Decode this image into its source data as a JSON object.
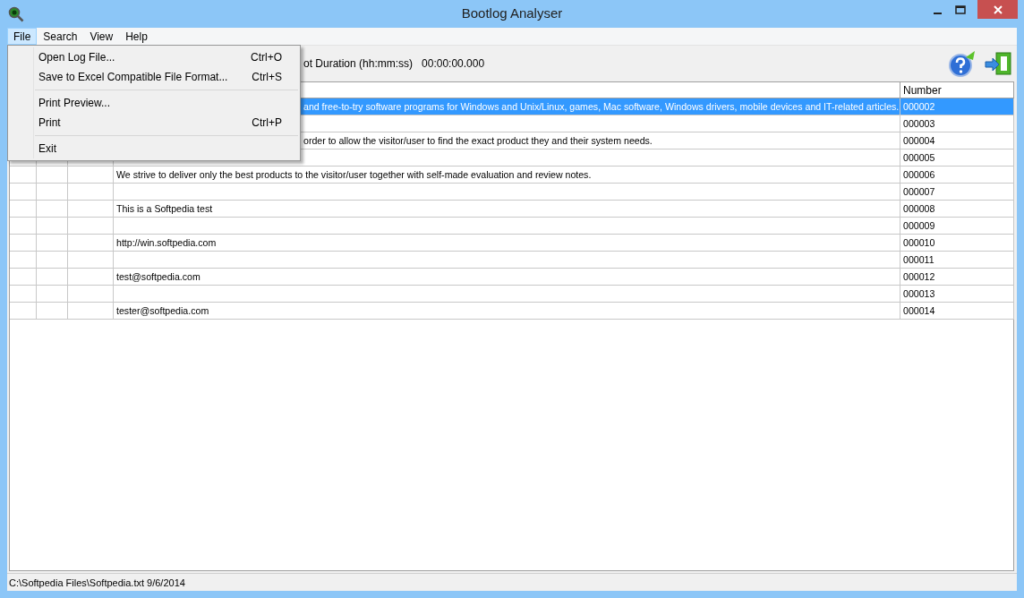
{
  "window": {
    "title": "Bootlog Analyser"
  },
  "menu_bar": [
    {
      "label": "File",
      "selected": true
    },
    {
      "label": "Search",
      "selected": false
    },
    {
      "label": "View",
      "selected": false
    },
    {
      "label": "Help",
      "selected": false
    }
  ],
  "file_menu": [
    {
      "kind": "item",
      "label": "Open Log File...",
      "shortcut": "Ctrl+O"
    },
    {
      "kind": "item",
      "label": "Save to Excel Compatible File Format...",
      "shortcut": "Ctrl+S"
    },
    {
      "kind": "separator"
    },
    {
      "kind": "item",
      "label": "Print Preview..."
    },
    {
      "kind": "item",
      "label": "Print",
      "shortcut": "Ctrl+P"
    },
    {
      "kind": "separator"
    },
    {
      "kind": "item",
      "label": "Exit"
    }
  ],
  "toolbar": {
    "duration_label": "ot Duration (hh:mm:ss)",
    "duration_value": "00:00:00.000"
  },
  "table": {
    "columns": [
      {
        "label": "Number"
      }
    ],
    "rows": [
      {
        "text": "and free-to-try software programs for Windows and Unix/Linux, games, Mac software, Windows drivers, mobile devices and IT-related articles.",
        "number": "000002",
        "selected": true
      },
      {
        "number": "000003",
        "selected": false
      },
      {
        "text": "order to allow the visitor/user to find the exact product they and their system needs.",
        "number": "000004",
        "selected": false
      },
      {
        "number": "000005",
        "selected": false
      },
      {
        "text": "We strive to deliver only the best products to the visitor/user together with self-made evaluation and review notes.",
        "number": "000006",
        "selected": false
      },
      {
        "number": "000007",
        "selected": false
      },
      {
        "text": "This is a Softpedia test",
        "number": "000008",
        "selected": false
      },
      {
        "number": "000009",
        "selected": false
      },
      {
        "text": "http://win.softpedia.com",
        "number": "000010",
        "selected": false
      },
      {
        "number": "000011",
        "selected": false
      },
      {
        "text": "test@softpedia.com",
        "number": "000012",
        "selected": false
      },
      {
        "number": "000013",
        "selected": false
      },
      {
        "text": "tester@softpedia.com",
        "number": "000014",
        "selected": false
      }
    ]
  },
  "status_bar": "C:\\Softpedia Files\\Softpedia.txt 9/6/2014"
}
